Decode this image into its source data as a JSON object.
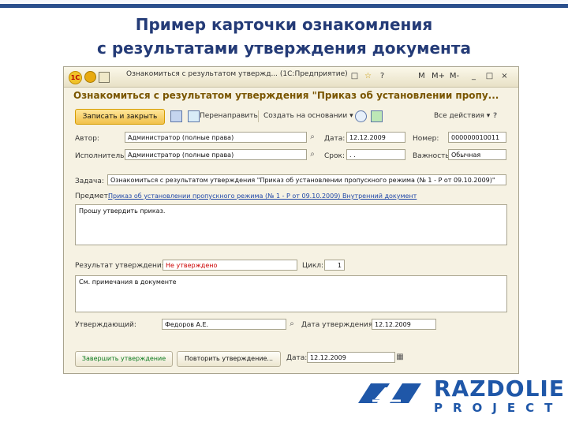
{
  "slide_title_line1": "Пример карточки ознакомления",
  "slide_title_line2": "с результатами утверждения документа",
  "window": {
    "title": "Ознакомиться с результатом утвержд... (1С:Предприятие)",
    "controls": [
      "□",
      "☆",
      "?",
      "M",
      "M+",
      "M-",
      "_",
      "□",
      "×"
    ]
  },
  "form": {
    "header": "Ознакомиться с результатом утверждения \"Приказ об установлении пропу...",
    "toolbar": {
      "save_close": "Записать и закрыть",
      "redirect": "Перенаправить",
      "create_based_on": "Создать на основании ▾",
      "all_actions": "Все действия ▾"
    },
    "author_label": "Автор:",
    "author_value": "Администратор (полные права)",
    "date_label": "Дата:",
    "date_value": "12.12.2009",
    "number_label": "Номер:",
    "number_value": "000000010011",
    "performer_label": "Исполнитель:",
    "performer_value": "Администратор (полные права)",
    "deadline_label": "Срок:",
    "deadline_value": ". .",
    "importance_label": "Важность:",
    "importance_value": "Обычная",
    "task_label": "Задача:",
    "task_value": "Ознакомиться с результатом утверждения \"Приказ об установлении пропускного режима (№ 1 - Р от 09.10.2009)\"",
    "subject_label": "Предмет:",
    "subject_value": "Приказ об установлении пропускного режима (№ 1 - Р от 09.10.2009) Внутренний документ",
    "description_text": "Прошу утвердить приказ.",
    "approval_result_label": "Результат утверждения:",
    "approval_result_value": "Не утверждено",
    "cycle_label": "Цикл:",
    "cycle_value": "1",
    "notes_text": "См. примечания в документе",
    "approver_label": "Утверждающий:",
    "approver_value": "Федоров А.Е.",
    "approval_date_label": "Дата утверждения:",
    "approval_date_value": "12.12.2009",
    "complete_button": "Завершить утверждение",
    "repeat_button": "Повторить утверждение...",
    "bottom_date_label": "Дата:",
    "bottom_date_value": "12.12.2009",
    "colors": {
      "header": "#7a5600",
      "link": "#1f47a8",
      "error": "#cc0000",
      "complete": "#0a7a1e"
    }
  },
  "logo": {
    "name": "RAZDOLIE",
    "sub": "PROJECT"
  }
}
